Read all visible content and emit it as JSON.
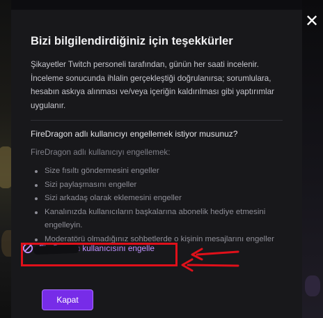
{
  "dialog": {
    "title": "Bizi bilgilendirdiğiniz için teşekkürler",
    "body": "Şikayetler Twitch personeli tarafından, günün her saati incelenir. İnceleme sonucunda ihlalin gerçekleştiği doğrulanırsa; sorumlulara, hesabın askıya alınması ve/veya içeriğin kaldırılması gibi yaptırımlar uygulanır.",
    "question": "FireDragon adlı kullanıcıyı engellemek istiyor musunuz?",
    "block_intro": "FireDragon adlı kullanıcıyı engellemek:",
    "effects": [
      "Size fısıltı göndermesini engeller",
      "Sizi paylaşmasını engeller",
      "Sizi arkadaş olarak eklemesini engeller",
      "Kanalınızda kullanıcıların başkalarına abonelik hediye etmesini engelleyin.",
      "Moderatörü olmadığınız sohbetlerde o kişinin mesajlarını engeller"
    ],
    "block_action_label": "FireDragon kullanıcısını engelle",
    "close_button": "Kapat"
  },
  "overlay": {
    "close_glyph": "✕"
  },
  "icons": {
    "overlay_close": "close-icon",
    "block": "ban-icon"
  },
  "colors": {
    "modal_bg": "#18181b",
    "accent": "#772ce8",
    "link": "#bf94ff",
    "annotation": "#e0101a"
  }
}
